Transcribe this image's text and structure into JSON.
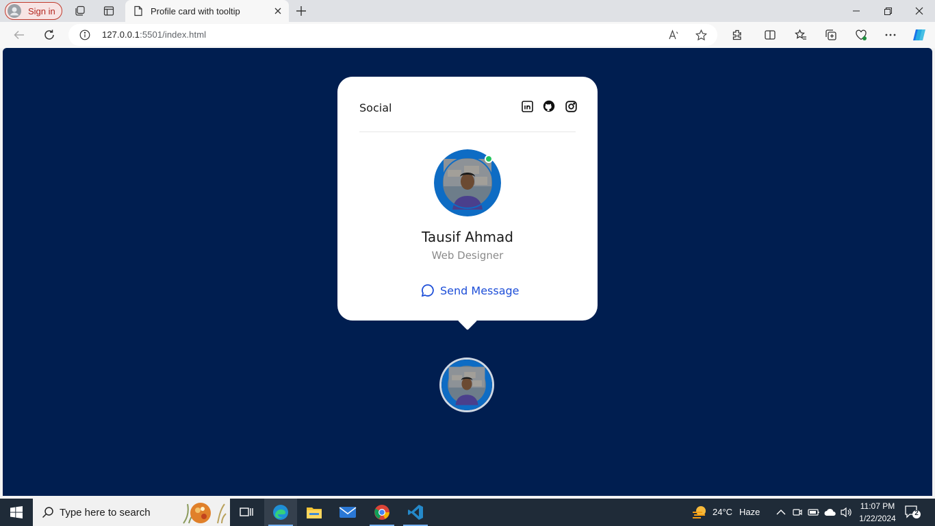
{
  "browser": {
    "signin_label": "Sign in",
    "tab_title": "Profile card with tooltip",
    "url_host": "127.0.0.1",
    "url_path": ":5501/index.html"
  },
  "card": {
    "social_label": "Social",
    "social_icons": [
      "linkedin-icon",
      "github-icon",
      "instagram-icon"
    ],
    "name": "Tausif Ahmad",
    "role": "Web Designer",
    "send_message_label": "Send Message",
    "status": "online"
  },
  "colors": {
    "page_bg": "#001e50",
    "card_bg": "#ffffff",
    "accent": "#1d4ed8",
    "online": "#22c55e"
  },
  "taskbar": {
    "search_placeholder": "Type here to search",
    "weather_temp": "24°C",
    "weather_desc": "Haze",
    "time": "11:07 PM",
    "date": "1/22/2024",
    "notification_count": "2"
  }
}
